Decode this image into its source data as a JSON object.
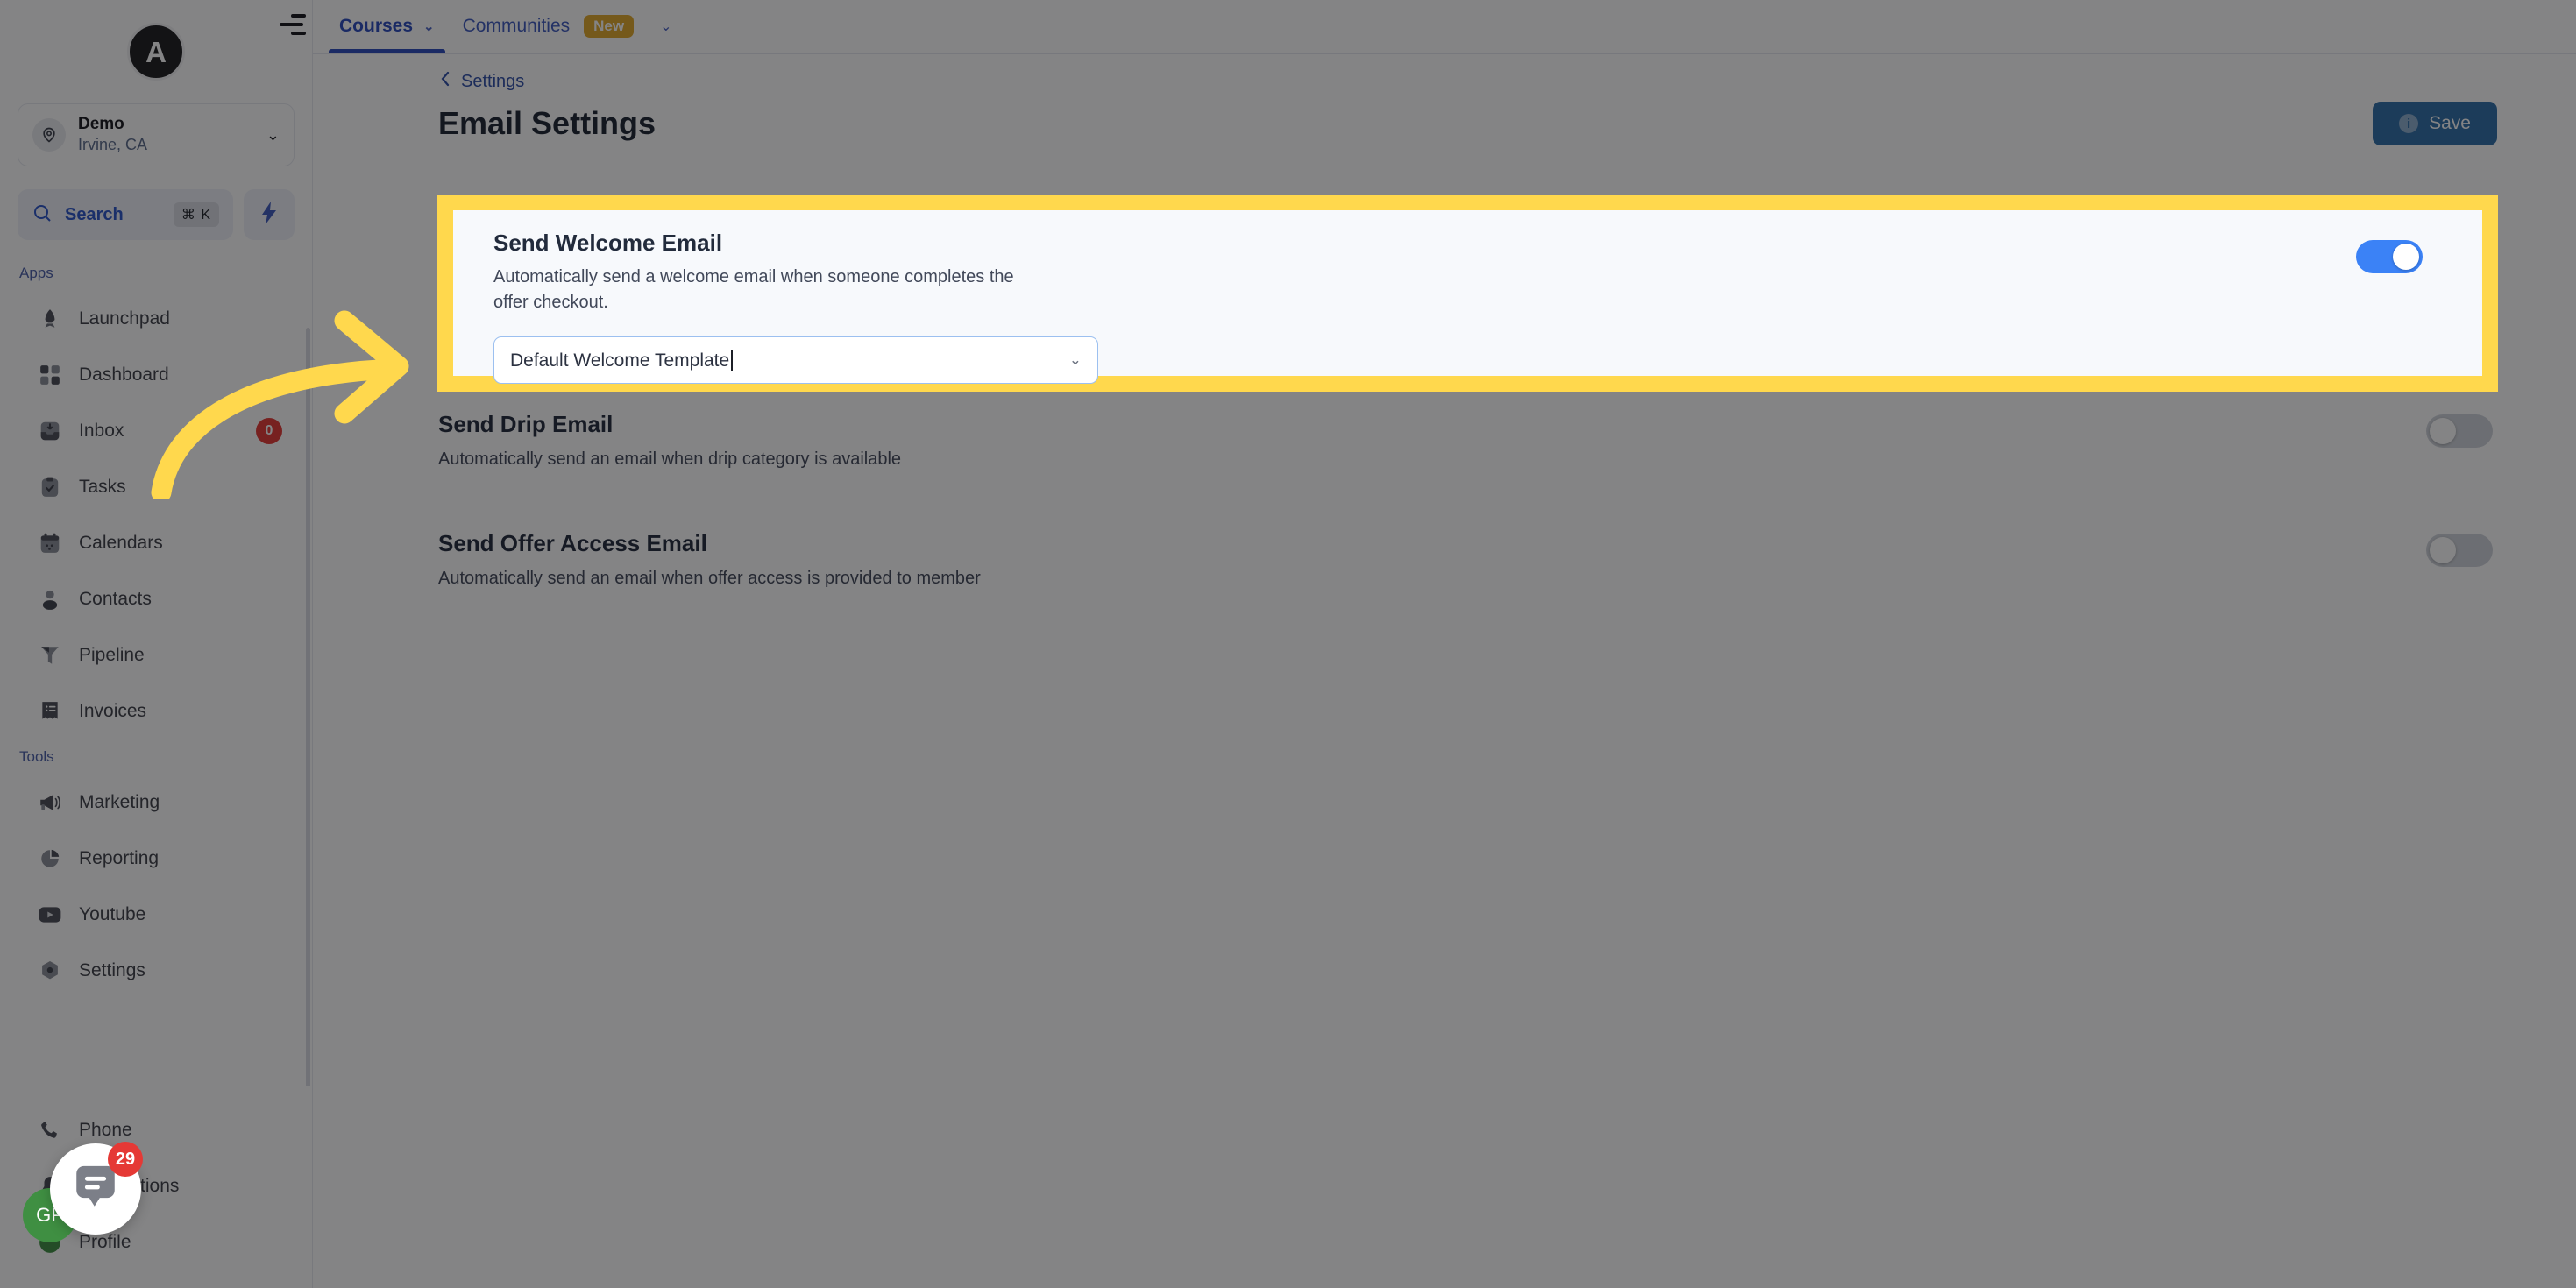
{
  "brand": {
    "logo_glyph": "A"
  },
  "location": {
    "name": "Demo",
    "sub": "Irvine, CA",
    "icon": "location-pin-icon",
    "chevron": "⌄"
  },
  "search": {
    "label": "Search",
    "shortcut": "⌘ K",
    "icon": "search-icon",
    "bolt_icon": "lightning-bolt-icon"
  },
  "sidebar": {
    "sections": [
      {
        "label": "Apps",
        "items": [
          {
            "label": "Launchpad",
            "icon": "rocket-icon",
            "badge": null
          },
          {
            "label": "Dashboard",
            "icon": "grid-icon",
            "badge": null
          },
          {
            "label": "Inbox",
            "icon": "inbox-icon",
            "badge": "0"
          },
          {
            "label": "Tasks",
            "icon": "clipboard-check-icon",
            "badge": null
          },
          {
            "label": "Calendars",
            "icon": "calendar-icon",
            "badge": null
          },
          {
            "label": "Contacts",
            "icon": "person-icon",
            "badge": null
          },
          {
            "label": "Pipeline",
            "icon": "funnel-icon",
            "badge": null
          },
          {
            "label": "Invoices",
            "icon": "receipt-list-icon",
            "badge": null
          }
        ]
      },
      {
        "label": "Tools",
        "items": [
          {
            "label": "Marketing",
            "icon": "megaphone-icon",
            "badge": null
          },
          {
            "label": "Reporting",
            "icon": "pie-chart-icon",
            "badge": null
          },
          {
            "label": "Youtube",
            "icon": "youtube-icon",
            "badge": null
          },
          {
            "label": "Settings",
            "icon": "gear-hex-icon",
            "badge": null
          }
        ]
      }
    ],
    "footer_items": [
      {
        "label": "Phone",
        "icon": "phone-icon",
        "badge": null
      },
      {
        "label": "Notifications",
        "icon": "bell-icon",
        "badge": null
      },
      {
        "label": "Profile",
        "icon": "avatar-icon",
        "badge": null
      }
    ]
  },
  "topbar": {
    "menu_icon": "hamburger-menu-icon",
    "tabs": [
      {
        "label": "Courses",
        "active": true,
        "caret": "⌄",
        "badge": null
      },
      {
        "label": "Communities",
        "active": false,
        "caret": null,
        "badge": "New"
      }
    ],
    "overflow_caret": "⌄"
  },
  "main": {
    "breadcrumb": {
      "back_icon": "chevron-left-icon",
      "label": "Settings"
    },
    "page_title": "Email Settings",
    "save_button": {
      "label": "Save",
      "icon": "info-icon"
    }
  },
  "settings": [
    {
      "title": "Send Welcome Email",
      "description": "Automatically send a welcome email when someone completes the offer checkout.",
      "toggle_state": "on",
      "select": {
        "value": "Default Welcome Template",
        "caret": "⌄",
        "focused": true
      },
      "highlighted": true
    },
    {
      "title": "Send Drip Email",
      "description": "Automatically send an email when drip category is available",
      "toggle_state": "off",
      "select": null,
      "highlighted": false
    },
    {
      "title": "Send Offer Access Email",
      "description": "Automatically send an email when offer access is provided to member",
      "toggle_state": "off",
      "select": null,
      "highlighted": false
    }
  ],
  "annotation": {
    "arrow_color": "#ffd84d",
    "highlight_color": "#ffd84d",
    "description": "curved arrow pointing right at the Send Welcome Email card"
  },
  "chat_widget": {
    "icon": "chat-bubble-icon",
    "badge": "29"
  },
  "colors": {
    "accent_blue": "#2a4bbd",
    "toggle_on": "#3b82f6",
    "toggle_off": "#cfd3da",
    "save_blue": "#2f6ea8",
    "badge_red": "#e53935",
    "new_badge": "#e0a92a",
    "highlight_yellow": "#ffd84d"
  }
}
